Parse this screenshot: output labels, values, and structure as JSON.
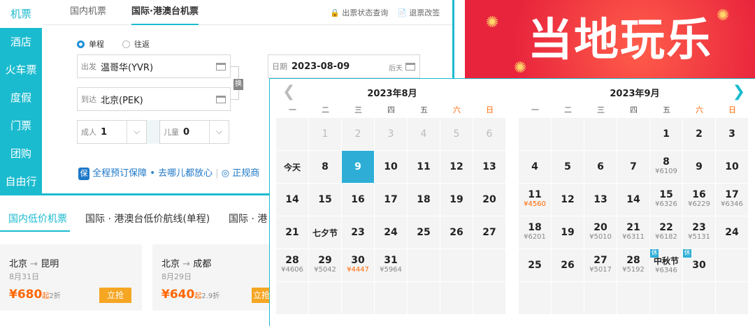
{
  "sidebar": {
    "items": [
      "机票",
      "酒店",
      "火车票",
      "度假",
      "门票",
      "团购",
      "自由行"
    ]
  },
  "tabs": [
    "国内机票",
    "国际·港澳台机票"
  ],
  "toplinks": [
    "出票状态查询",
    "退票改签"
  ],
  "trip": {
    "oneway": "单程",
    "roundtrip": "往返"
  },
  "form": {
    "from_label": "出发",
    "from_value": "温哥华(YVR)",
    "to_label": "到达",
    "to_value": "北京(PEK)",
    "swap": "换",
    "date_label": "日期",
    "date_value": "2023-08-09",
    "date_hint": "后天",
    "adult_label": "成人",
    "adult_value": "1",
    "child_label": "儿童",
    "child_value": "0"
  },
  "guarantee": "全程预订保障 • 去哪儿都放心",
  "guarantee_more": "正规商",
  "bottom_tabs": [
    "国内低价机票",
    "国际 · 港澳台低价航线(单程)",
    "国际 · 港"
  ],
  "cards": [
    {
      "from": "北京",
      "to": "昆明",
      "date": "8月31日",
      "price": "680",
      "unit": "起",
      "discount": "2折",
      "button": "立抢"
    },
    {
      "from": "北京",
      "to": "成都",
      "date": "8月29日",
      "price": "640",
      "unit": "起",
      "discount": "2.9折",
      "button": "立抢"
    }
  ],
  "banner": {
    "text": "当地玩乐"
  },
  "calendar": {
    "weekdays": [
      "一",
      "二",
      "三",
      "四",
      "五",
      "六",
      "日"
    ],
    "months": [
      {
        "title": "2023年8月",
        "rows": [
          [
            null,
            {
              "d": "1",
              "dim": true
            },
            {
              "d": "2",
              "dim": true
            },
            {
              "d": "3",
              "dim": true
            },
            {
              "d": "4",
              "dim": true
            },
            {
              "d": "5",
              "dim": true
            },
            {
              "d": "6",
              "dim": true
            }
          ],
          [
            {
              "d": "今天",
              "txt": true
            },
            {
              "d": "8"
            },
            {
              "d": "9",
              "sel": true
            },
            {
              "d": "10"
            },
            {
              "d": "11"
            },
            {
              "d": "12"
            },
            {
              "d": "13"
            }
          ],
          [
            {
              "d": "14"
            },
            {
              "d": "15"
            },
            {
              "d": "16"
            },
            {
              "d": "17"
            },
            {
              "d": "18"
            },
            {
              "d": "19"
            },
            {
              "d": "20"
            }
          ],
          [
            {
              "d": "21"
            },
            {
              "d": "七夕节",
              "txt": true
            },
            {
              "d": "23"
            },
            {
              "d": "24"
            },
            {
              "d": "25"
            },
            {
              "d": "26"
            },
            {
              "d": "27"
            }
          ],
          [
            {
              "d": "28",
              "p": "¥4606"
            },
            {
              "d": "29",
              "p": "¥5042"
            },
            {
              "d": "30",
              "p": "¥4447",
              "low": true
            },
            {
              "d": "31",
              "p": "¥5964"
            },
            null,
            null,
            null
          ],
          [
            null,
            null,
            null,
            null,
            null,
            null,
            null
          ]
        ]
      },
      {
        "title": "2023年9月",
        "rows": [
          [
            null,
            null,
            null,
            null,
            {
              "d": "1"
            },
            {
              "d": "2"
            },
            {
              "d": "3"
            }
          ],
          [
            {
              "d": "4"
            },
            {
              "d": "5"
            },
            {
              "d": "6"
            },
            {
              "d": "7"
            },
            {
              "d": "8",
              "p": "¥6109"
            },
            {
              "d": "9"
            },
            {
              "d": "10"
            }
          ],
          [
            {
              "d": "11",
              "p": "¥4560",
              "low": true
            },
            {
              "d": "12"
            },
            {
              "d": "13"
            },
            {
              "d": "14"
            },
            {
              "d": "15",
              "p": "¥6326"
            },
            {
              "d": "16",
              "p": "¥6229"
            },
            {
              "d": "17",
              "p": "¥6346"
            }
          ],
          [
            {
              "d": "18",
              "p": "¥6201"
            },
            {
              "d": "19"
            },
            {
              "d": "20",
              "p": "¥5010"
            },
            {
              "d": "21",
              "p": "¥6311"
            },
            {
              "d": "22",
              "p": "¥6182"
            },
            {
              "d": "23",
              "p": "¥5131"
            },
            {
              "d": "24"
            }
          ],
          [
            {
              "d": "25"
            },
            {
              "d": "26"
            },
            {
              "d": "27",
              "p": "¥5017"
            },
            {
              "d": "28",
              "p": "¥5192"
            },
            {
              "d": "中秋节",
              "p": "¥6346",
              "rest": "休",
              "txt": true
            },
            {
              "d": "30",
              "rest": "休"
            },
            null
          ],
          [
            null,
            null,
            null,
            null,
            null,
            null,
            null
          ]
        ]
      }
    ]
  }
}
